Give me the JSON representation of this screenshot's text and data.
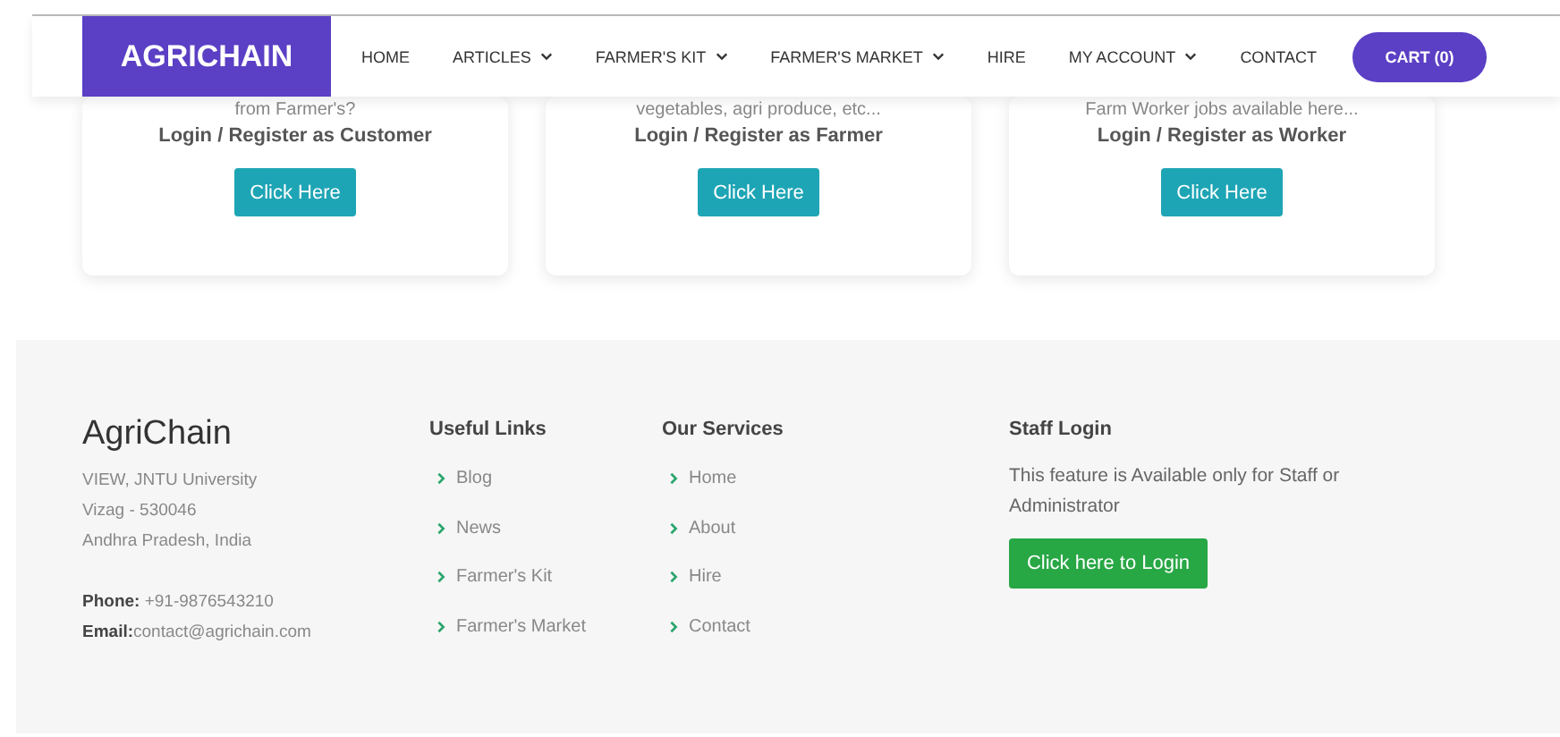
{
  "header": {
    "logo": "AGRICHAIN",
    "nav": [
      {
        "label": "HOME",
        "dropdown": false
      },
      {
        "label": "ARTICLES",
        "dropdown": true
      },
      {
        "label": "FARMER'S KIT",
        "dropdown": true
      },
      {
        "label": "FARMER'S MARKET",
        "dropdown": true
      },
      {
        "label": "HIRE",
        "dropdown": false
      },
      {
        "label": "MY ACCOUNT",
        "dropdown": true
      },
      {
        "label": "CONTACT",
        "dropdown": false
      }
    ],
    "cart": "CART (0)"
  },
  "cards": [
    {
      "description": "from Farmer's?",
      "login": "Login / Register as Customer",
      "button": "Click Here"
    },
    {
      "description": "vegetables, agri produce, etc...",
      "login": "Login / Register as Farmer",
      "button": "Click Here"
    },
    {
      "description": "Farm Worker jobs available here...",
      "login": "Login / Register as Worker",
      "button": "Click Here"
    }
  ],
  "footer": {
    "brand": "AgriChain",
    "address": [
      "VIEW, JNTU University",
      "Vizag - 530046",
      "Andhra Pradesh, India"
    ],
    "phone": {
      "label": "Phone:",
      "value": " +91-9876543210"
    },
    "email": {
      "label": "Email:",
      "value": "contact@agrichain.com"
    },
    "useful_links": {
      "title": "Useful Links",
      "items": [
        "Blog",
        "News",
        "Farmer's Kit",
        "Farmer's Market"
      ]
    },
    "our_services": {
      "title": "Our Services",
      "items": [
        "Home",
        "About",
        "Hire",
        "Contact"
      ]
    },
    "staff_login": {
      "title": "Staff Login",
      "text": "This feature is Available only for Staff or Administrator",
      "button": "Click here to Login"
    }
  }
}
